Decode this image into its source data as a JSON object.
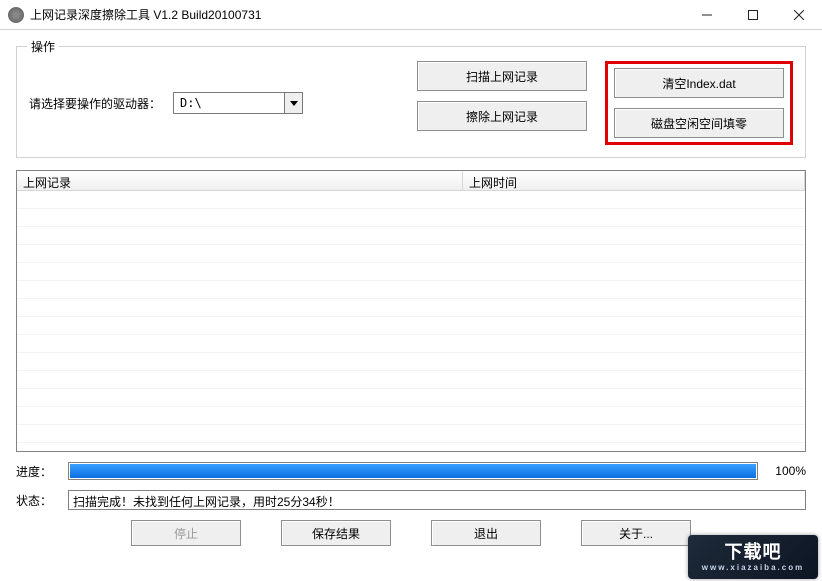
{
  "window": {
    "title": "上网记录深度擦除工具 V1.2   Build20100731"
  },
  "group": {
    "legend": "操作",
    "drive_label": "请选择要操作的驱动器：",
    "drive_value": "D:\\",
    "btn_scan": "扫描上网记录",
    "btn_wipe": "擦除上网记录",
    "btn_clear_index": "清空Index.dat",
    "btn_fill_zero": "磁盘空闲空间填零"
  },
  "list": {
    "col1": "上网记录",
    "col2": "上网时间"
  },
  "progress": {
    "label": "进度：",
    "percent_text": "100%",
    "percent_value": 100
  },
  "status": {
    "label": "状态：",
    "text": "扫描完成！未找到任何上网记录，用时25分34秒！"
  },
  "bottom": {
    "stop": "停止",
    "save": "保存结果",
    "exit": "退出",
    "about": "关于..."
  },
  "watermark": {
    "line1": "下载吧",
    "line2": "www.xiazaiba.com"
  }
}
